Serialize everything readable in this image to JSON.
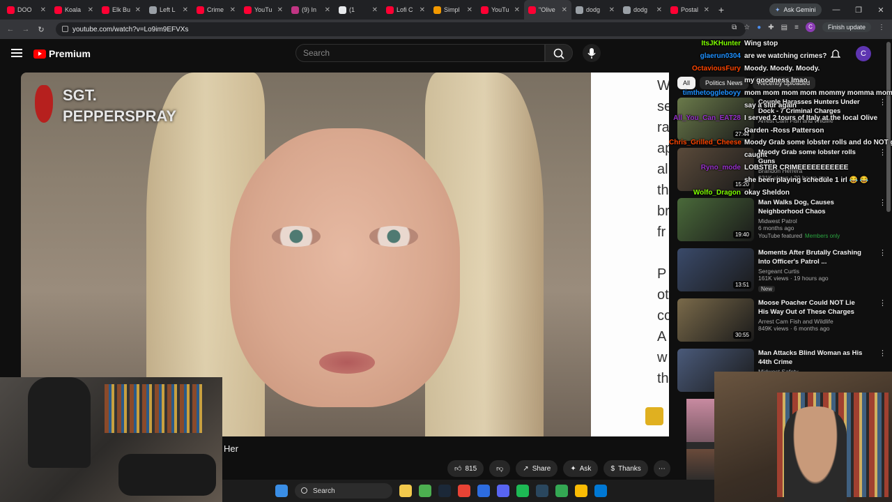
{
  "browser": {
    "tabs": [
      {
        "label": "DOO",
        "color": "#ff0033"
      },
      {
        "label": "Koala",
        "color": "#ff0033"
      },
      {
        "label": "Elk Bu",
        "color": "#ff0033"
      },
      {
        "label": "Left L",
        "color": "#9aa0a6"
      },
      {
        "label": "Crime",
        "color": "#ff0033"
      },
      {
        "label": "YouTu",
        "color": "#ff0033"
      },
      {
        "label": "(9) In",
        "color": "#c13584"
      },
      {
        "label": "(1",
        "color": "#e8eaed"
      },
      {
        "label": "Lofi C",
        "color": "#ff0033"
      },
      {
        "label": "Simpl",
        "color": "#f29900"
      },
      {
        "label": "YouTu",
        "color": "#ff0033"
      },
      {
        "label": "\"Olive",
        "color": "#ff0033",
        "active": true
      },
      {
        "label": "dodg",
        "color": "#9aa0a6"
      },
      {
        "label": "dodg",
        "color": "#9aa0a6"
      },
      {
        "label": "Postal",
        "color": "#ff0033"
      }
    ],
    "new_tab": "+",
    "gemini_label": "Ask Gemini",
    "url": "youtube.com/watch?v=Lo9im9EFVXs",
    "finish_update": "Finish update",
    "profile_initial": "C"
  },
  "youtube": {
    "logo_text": "Premium",
    "search_placeholder": "Search",
    "avatar_initial": "C",
    "video": {
      "overlay_brand_line1": "SGT.",
      "overlay_brand_line2": "PEPPERSPRAY",
      "side_letters": [
        "W",
        "se",
        "ra",
        "ap",
        "al",
        "th",
        "br",
        "fr",
        "",
        "P",
        "ot",
        "cc",
        "A",
        "w",
        "th"
      ],
      "title": "Her"
    },
    "actions": {
      "likes": "815",
      "share": "Share",
      "ask": "Ask",
      "thanks": "Thanks"
    },
    "chips": [
      "All",
      "Politics News",
      "Recently uploaded"
    ],
    "recommendations": [
      {
        "title": "Couple Harasses Hunters Under Dock - 7 Criminal Charges",
        "channel": "Arrest Cam Fish and Wildlife",
        "meta": "",
        "duration": "27:44",
        "thumb": "#6a7a4a"
      },
      {
        "title": "Moody Grab some lobster rolls Guns",
        "channel": "Brandon Herrera",
        "meta": "331K views · 20 hours ago",
        "duration": "15:20",
        "thumb": "#5a4a3a"
      },
      {
        "title": "Man Walks Dog, Causes Neighborhood Chaos",
        "channel": "Midwest Patrol",
        "meta": "6 months ago",
        "duration": "19:40",
        "thumb": "#4a6a3a",
        "badge": "YouTube featured",
        "badge2": "Members only"
      },
      {
        "title": "Moments After Brutally Crashing Into Officer's Patrol ...",
        "channel": "Sergeant Curtis",
        "meta": "161K views · 19 hours ago",
        "duration": "13:51",
        "thumb": "#3a4a6a",
        "new": "New"
      },
      {
        "title": "Moose Poacher Could NOT Lie His Way Out of These Charges",
        "channel": "Arrest Cam Fish and Wildlife",
        "meta": "849K views · 6 months ago",
        "duration": "30:55",
        "thumb": "#7a6a4a"
      },
      {
        "title": "Man Attacks Blind Woman as His 44th Crime",
        "channel": "Midwest Safety",
        "meta": "",
        "duration": "",
        "thumb": "#4a5a7a"
      }
    ]
  },
  "chat": [
    {
      "user": "ItsJKHunter",
      "color": "#7fff00",
      "msg": "Wing stop"
    },
    {
      "user": "glaerun0304",
      "color": "#1e90ff",
      "msg": "are we watching crimes?"
    },
    {
      "user": "OctaviousFury",
      "color": "#ff4500",
      "msg": "Moody. Moody. Moody."
    },
    {
      "user": "",
      "color": "#ff4500",
      "msg": "my goodness lmao"
    },
    {
      "user": "timthetoggleboyy",
      "color": "#1e90ff",
      "msg": "mom mom mom mom mommy momma mom"
    },
    {
      "user": "",
      "color": "#7fff00",
      "msg": "say a slur again"
    },
    {
      "user": "All_You_Can_EAT28",
      "color": "#9932cc",
      "msg": "I served 2 tours of Italy at the local Olive"
    },
    {
      "user": "",
      "color": "#9932cc",
      "msg": "Garden -Ross Patterson"
    },
    {
      "user": "Chris_Grilled_Cheese",
      "color": "#ff4500",
      "msg": "Moody Grab some lobster rolls and do NOT get"
    },
    {
      "user": "",
      "color": "#ff4500",
      "msg": "caught"
    },
    {
      "user": "Ryno_mode",
      "color": "#9932cc",
      "msg": "LOBSTER CRIMEEEEEEEEEEE"
    },
    {
      "user": "",
      "color": "#9932cc",
      "msg": "she been playing schedule 1 irl 😂 😂"
    },
    {
      "user": "Wolfo_Dragon",
      "color": "#7fff00",
      "msg": "okay Sheldon"
    }
  ],
  "taskbar": {
    "search_label": "Search",
    "icons": [
      {
        "name": "windows-start-icon",
        "color": "#3a8ee6"
      },
      {
        "name": "file-explorer-icon",
        "color": "#f2c94c"
      },
      {
        "name": "terminal-icon",
        "color": "#4caf50"
      },
      {
        "name": "steam-icon",
        "color": "#1b2838"
      },
      {
        "name": "chrome-icon",
        "color": "#e94335"
      },
      {
        "name": "app-icon",
        "color": "#2d6cdf"
      },
      {
        "name": "discord-icon",
        "color": "#5865f2"
      },
      {
        "name": "spotify-icon",
        "color": "#1db954"
      },
      {
        "name": "steam-icon-2",
        "color": "#2a475e"
      },
      {
        "name": "chrome-icon-2",
        "color": "#34a853"
      },
      {
        "name": "notes-icon",
        "color": "#fbbc04"
      },
      {
        "name": "browser-icon",
        "color": "#0078d4"
      }
    ]
  }
}
